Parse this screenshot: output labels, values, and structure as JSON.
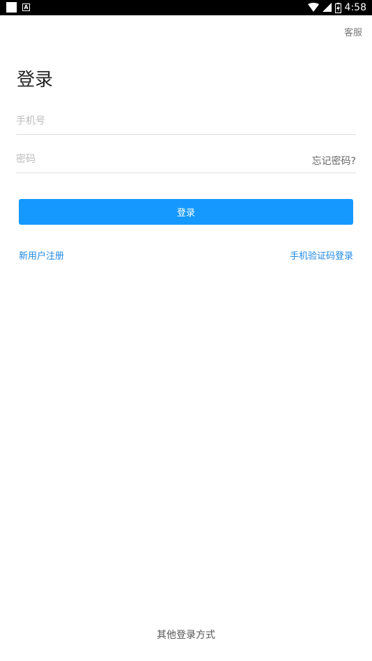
{
  "status_bar": {
    "time": "4:58",
    "notification_letter": "A"
  },
  "header": {
    "service_label": "客服"
  },
  "login": {
    "title": "登录",
    "phone_placeholder": "手机号",
    "password_placeholder": "密码",
    "forgot_password_label": "忘记密码?",
    "login_button_label": "登录",
    "register_label": "新用户注册",
    "sms_login_label": "手机验证码登录"
  },
  "footer": {
    "other_login_label": "其他登录方式"
  },
  "colors": {
    "primary": "#1699ff",
    "link": "#1e88e5",
    "status_bar": "#000000"
  }
}
